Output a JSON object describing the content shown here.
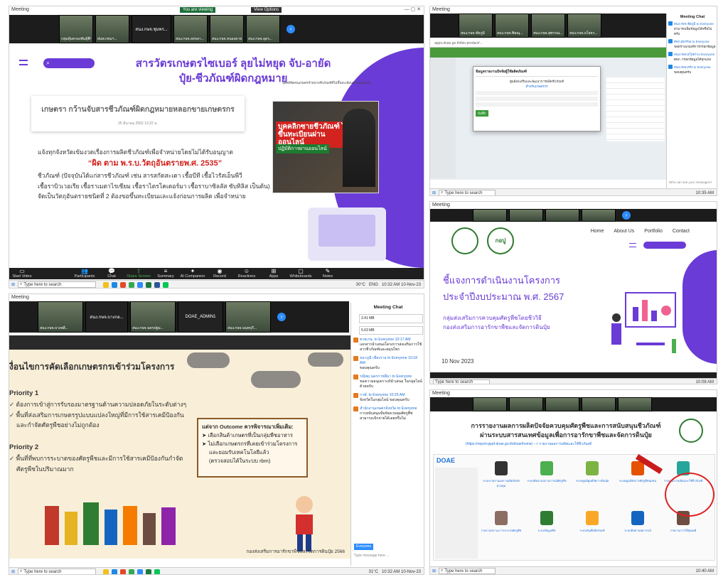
{
  "tl": {
    "window_title": "Meeting",
    "share_banner": "You are viewing ",
    "view_options": "View Options",
    "thumbs": [
      "กลุ่มคุ้มครองพันธุ์พืช...",
      "ฝนพ.กทมฯ...",
      "สนง.กษจ.สงขลา...",
      "สนง.กษจ.หนองคาย...",
      "สนง.กษจ.อุดร..."
    ],
    "thumb_black": "สนง.กษจ.ชุมพร...",
    "slide": {
      "headline1": "สารวัตรเกษตรไซเบอร์ ลุยไม่หยุด จับ-อายัด",
      "headline2": "ปุ๋ย-ชีวภัณฑ์ผิดกฎหมาย",
      "card_title": "เกษตรา กว้านจับสารชีวภัณฑ์ผิดกฎหมายหลอกขายเกษตรกร",
      "card_meta": "25 มีนาคม 2562 13:22 น.",
      "news_header": "บุคคลิซัลขนเกษตรจำหน่ายชีวภัณฑ์ที่ไม่ขึ้นทะเบียนผ่านออนไลน์",
      "news_red": "บุคคลิกซายชีวภัณฑ์ ไม่ขึ้นทะเบียนผ่านออนไลน์",
      "news_green": "ปฏิบัติการผ่านออนไลน์",
      "body1": "แจ้งทุกจังหวัดเข้มงวดเรื่องการผลิตชีวภัณฑ์เพื่อจำหน่ายโดยไม่ได้รับอนุญาต",
      "body_red": "“ผิด ตาม พ.ร.บ.วัตถุอันตรายพ.ศ. 2535”",
      "body2": "ชีวภัณฑ์ (ปัจจุบันได้แก่สารชีวภัณฑ์ เช่น สารสกัดสะเดา เชื้อบีที เชื้อไวรัสเอ็นพีวี",
      "body3": "เชื้อราบิวเวอเรีย เชื้อราเมตาไรเซียม เชื้อราไตรโคเดอร์มา เชื้อราบาซิลลัส ซับทิลิส เป็นต้น)",
      "body4": "จัดเป็นวัตถุอันตรายชนิดที่ 2 ต้องขอขึ้นทะเบียนและแจ้งก่อนการผลิต เพื่อจำหน่าย"
    },
    "toolbar": [
      "Start Video",
      "Participants",
      "Chat",
      "Share Screen",
      "Summary",
      "AI Companion",
      "Record",
      "Reactions",
      "Apps",
      "Whiteboards",
      "Notes"
    ],
    "participants_count": "915",
    "end": "End",
    "search": "Type here to search",
    "temp": "30°C",
    "lang": "ENG",
    "time": "10:32 AM",
    "date": "10-Nov-23"
  },
  "tr": {
    "window_title": "Meeting",
    "thumbs": [
      "สนง.กษจ.ชัยภูมิ",
      "สนง.กษจ.พิษณุ...",
      "สนง.กษจ.สุพรรณ...",
      "สนง.กษจ.ยโสธร..."
    ],
    "browser_url": "apps.doae.go.th/bio-product/...",
    "dialog_title": "ข้อมูลรายงานปัจจัยผู้ใช้ผลิตภัณฑ์",
    "dialog_line1": "ศูนย์ส่งเสริมและพัฒนาการผลิตชีวภัณฑ์",
    "dialog_line2": "สำหรับเกษตรกร",
    "dialog_btn": "บันทึก",
    "chat_title": "Meeting Chat",
    "chat": [
      {
        "from": "สนง.กษจ.ชัยภูมิ to Everyone",
        "text": "สามารถเพิ่มข้อมูลได้หรือไม่ครับ"
      },
      {
        "from": "ศพก.สุพรรณ to Everyone",
        "text": "ขอทราบเกณฑ์การกรอกข้อมูล"
      },
      {
        "from": "สนง.กษจ.ยโสธร to Everyone",
        "text": "ศพก. กรอกข้อมูลได้ทุกแห่ง"
      },
      {
        "from": "สนง.กษจ.ตรัง to Everyone",
        "text": "ขอบคุณครับ"
      }
    ],
    "chat_input": "Who can see your messages?",
    "search": "Type here to search",
    "time": "10:35 AM"
  },
  "mr": {
    "window_title": "Meeting",
    "nav": [
      "Home",
      "About Us",
      "Portfolio",
      "Contact"
    ],
    "logo_text": "กอปู",
    "headline1": "ชี้แจงการดำเนินงานโครงการ",
    "headline2": "ประจำปีงบประมาณ พ.ศ. 2567",
    "sub1": "กลุ่มส่งเสริมการควบคุมศัตรูพืชโดยชีววิธี",
    "sub2": "กองส่งเสริมการอารักขาพืชและจัดการดินปุ๋ย",
    "date": "10 Nov 2023",
    "search": "Type here to search",
    "time": "10:08 AM"
  },
  "bl": {
    "window_title": "Meeting",
    "thumbs": [
      "สนง.กษจ.บางพลี...",
      "สนง.กษจ.นครปฐม...",
      "DOAE_ADMIN1",
      "สนง.กษจ.นนทบุรี..."
    ],
    "thumb_black": "สนง.กษจ.บางกอ...",
    "title": "งื่อนไขการคัดเลือกเกษตรกรเข้าร่วมโครงการ",
    "priority1": "Priority 1",
    "p1a": "✓ ต้องการเข้าสู่การรับรองมาตรฐานด้านความปลอดภัยในระดับต่างๆ",
    "p1b": "✓ พื้นที่ส่งเสริมการเกษตรรูปแบบแปลงใหญ่ที่มีการใช้สารเคมีป้องกัน",
    "p1c": "และกำจัดศัตรูพืชอย่างไม่ถูกต้อง",
    "priority2": "Priority 2",
    "p2a": "✓ พื้นที่ที่พบการระบาดของศัตรูพืชและมีการใช้สารเคมีป้องกันกำจัด",
    "p2b": "ศัตรูพืชในปริมาณมาก",
    "box_title": "แต่จาก Outcome ควรพิจารณาเพิ่มเติม:",
    "box1": "➤ เลือกสินค้าเกษตรที่เป็นกลุ่มพืชอาหาร",
    "box2": "➤ ไม่เลือกเกษตรกรที่เคยเข้าร่วมโครงการ",
    "box3": "และยอมรับเทคโนโลยีแล้ว",
    "box4": "(ตรวจสอบได้ในระบบ rbm)",
    "footer": "กองส่งเสริมการอารักขาพืชและจัดการดินปุ๋ย 2566",
    "chat_title": "Meeting Chat",
    "chat": [
      {
        "from": "ศวพ.กษ. to Everyone 10:17 AM",
        "text": "เอกสารนำเสนอโครงการส่งเสริมการใช้สารชีวภัณฑ์และสมุนไพร"
      },
      {
        "from": "ธนาภูมิ เชียงราย to Everyone 10:18 AM",
        "text": "ขอบคุณครับ"
      },
      {
        "from": "รณิพฤ นครราชสีมา to Everyone",
        "text": "ขอความอนุเคราะห์นำเสนอ ในกลุ่มไลน์ด้วยครับ"
      },
      {
        "from": "กวฬ. to Everyone 10:25 AM",
        "text": "จังหวัดในกลุ่มไลน์ ขอบคุณครับ"
      },
      {
        "from": "สำนักงานเกษตรจังหวัด to Everyone",
        "text": "การสนับสนุนปัจจัยควบคุมศัตรูพืชสามารถเบิกจ่ายได้เลยหรือไม่"
      }
    ],
    "file1": "3.41 MB",
    "file2": "5.63 MB",
    "to_label": "Everyone",
    "chat_input": "Type message here ...",
    "search": "Type here to search",
    "temp": "31°C",
    "time": "10:32 AM",
    "date": "10-Nov-23"
  },
  "br": {
    "window_title": "Meeting",
    "headline1": "การรายงานผลการผลิตปัจจัยควบคุมศัตรูพืชและการสนับสนุนชีวภัณฑ์",
    "headline2": "ผ่านระบบสารสนเทศข้อมูลเพื่อการอารักขาพืชและจัดการดินปุ๋ย",
    "url": "(https://report-pppf.doae.go.th/doae/home) --> รายงานผลการผลิตและใช้ชีวภัณฑ์",
    "tiles": [
      "ระบบรายงานผลการผลิตปัจจัยควบคุม",
      "ระบบติดตามสถานการณ์ศัตรูพืช",
      "ระบบศูนย์ศูนย์จัดการดินปุ๋ย",
      "ระบบศูนย์จัดการศัตรูพืชชุมชน",
      "รายงานการผลิตและใช้ชีวภัณฑ์",
      "รายงานสถานะการระบาดศัตรูพืช",
      "ระบบข้อมูลพืช",
      "ระบบบัญชีผลิตภัณฑ์",
      "ระบบติดตามพยากรณ์",
      "รายงานการใช้ปุ๋ยเคมี"
    ],
    "search": "Type here to search",
    "time": "10:40 AM"
  }
}
